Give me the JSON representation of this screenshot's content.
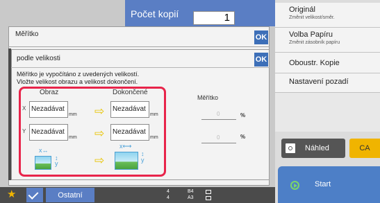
{
  "header": {
    "copies_label": "Počet kopií",
    "copies_value": "1"
  },
  "right_panel": {
    "original": {
      "label": "Originál",
      "sub": "Změnit velikost/směr."
    },
    "paper": {
      "label": "Volba Papíru",
      "sub": "Změnit zásobník papíru"
    },
    "duplex": {
      "label": "Oboustr. Kopie"
    },
    "background": {
      "label": "Nastavení pozadí"
    },
    "preview_label": "Náhled",
    "ca_label": "CA",
    "start_label": "Start"
  },
  "bottom_bar": {
    "other_label": "Ostatní",
    "tray_4": "4",
    "tray_b4": "B4",
    "tray_a3_num": "4",
    "tray_a3": "A3"
  },
  "dialog_scale": {
    "title": "Měřítko",
    "ok": "OK"
  },
  "dialog_size": {
    "title": "podle velikosti",
    "ok": "OK",
    "desc_line1": "Měřítko je vypočítáno z uvedených velikostí.",
    "desc_line2": "Vložte velikost obrazu a velikost dokončení.",
    "header_image": "Obraz",
    "header_result": "Dokončené",
    "axis_x": "X",
    "axis_y": "Y",
    "field_placeholder": "Nezadávat",
    "unit": "mm",
    "scale_label": "Měřítko",
    "pct_x": "0",
    "pct_y": "0",
    "pct_sign": "%"
  },
  "colors": {
    "accent_blue": "#5a7ec4",
    "ok_blue": "#3d6fb8",
    "highlight_red": "#e8244a",
    "arrow_yellow": "#e8c400",
    "ca_yellow": "#f0b400"
  }
}
